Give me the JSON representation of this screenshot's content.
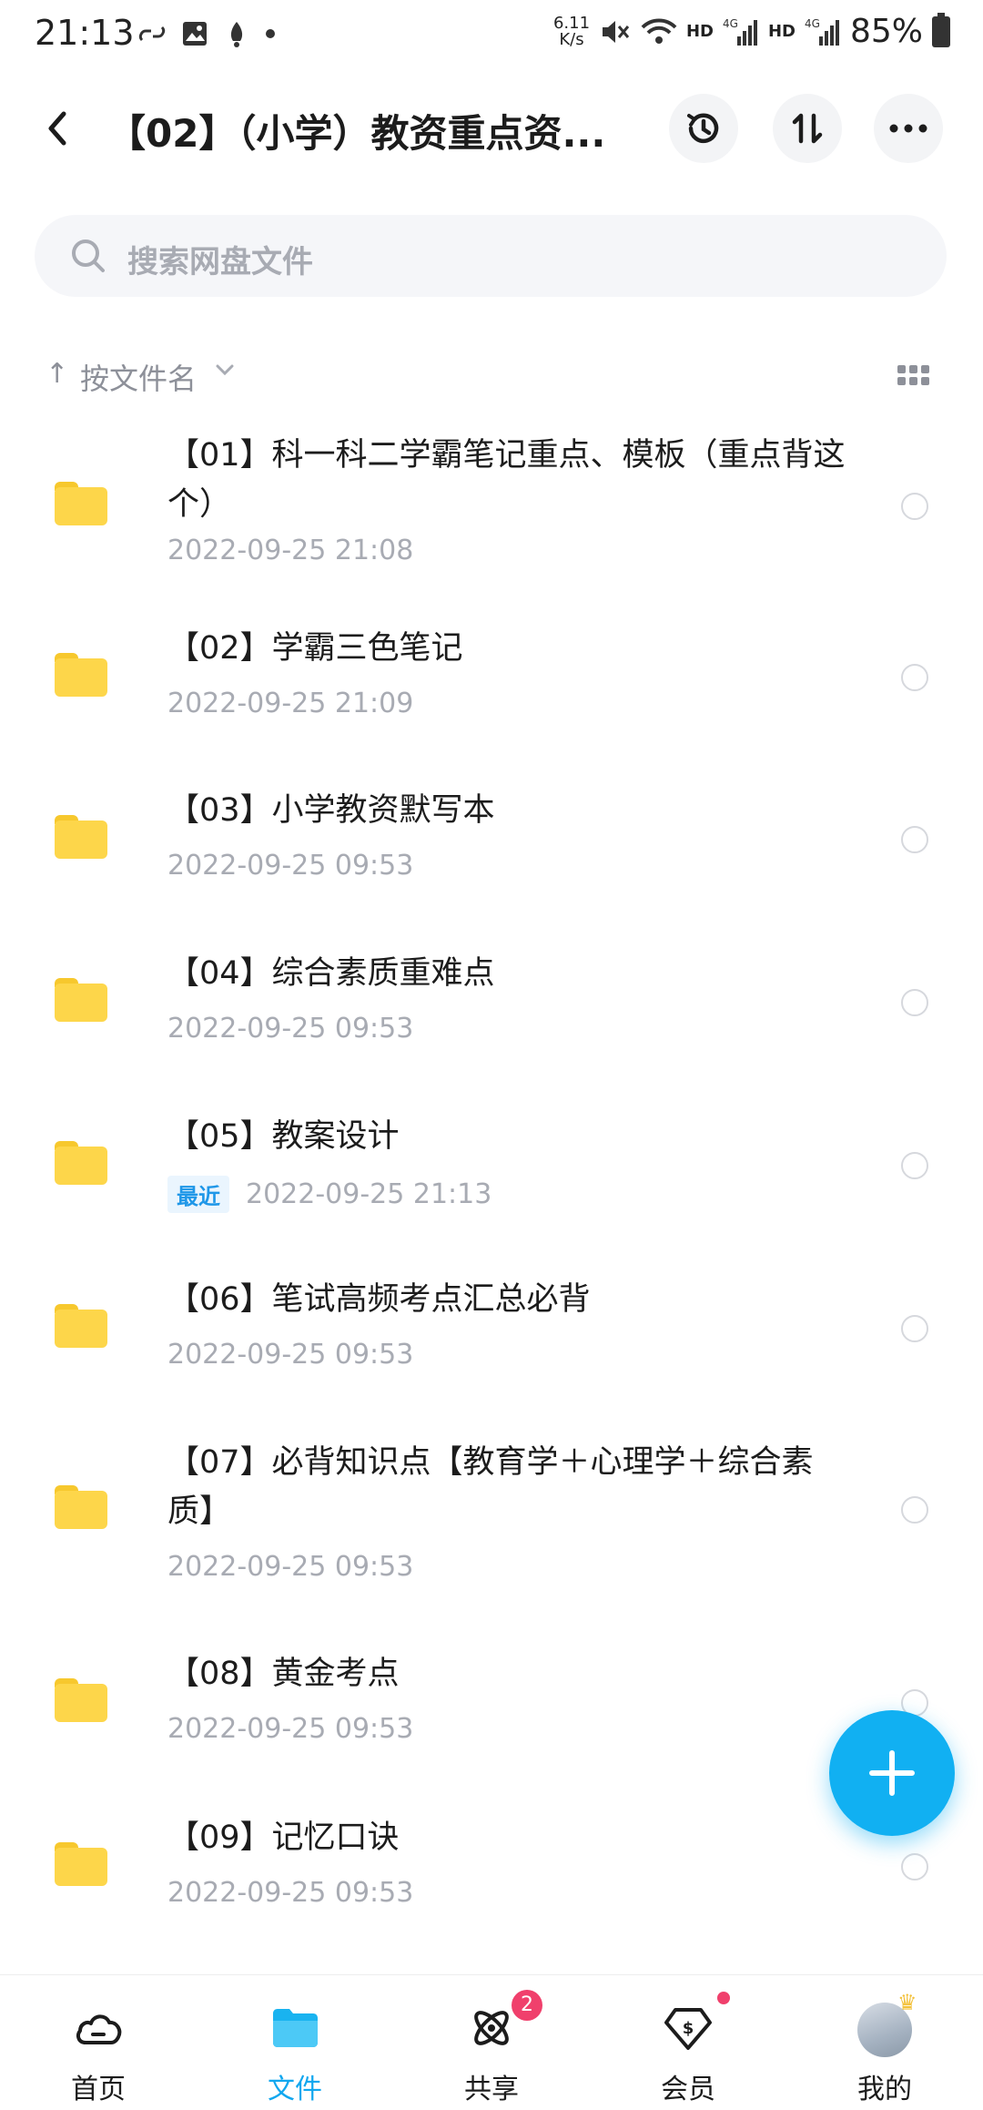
{
  "status_bar": {
    "time": "21:13",
    "net_speed_value": "6.11",
    "net_speed_unit": "K/s",
    "hd1": "HD",
    "hd2": "HD",
    "signal_label1": "4G",
    "signal_label2": "4G",
    "battery": "85%"
  },
  "header": {
    "title": "【02】（小学）教资重点资...",
    "icons": [
      "back-icon",
      "history-icon",
      "sort-icon",
      "more-icon"
    ]
  },
  "search": {
    "placeholder": "搜索网盘文件"
  },
  "sort": {
    "arrow": "↑",
    "label": "按文件名"
  },
  "files": [
    {
      "name": "【01】科一科二学霸笔记重点、模板（重点背这个）",
      "date": "2022-09-25  21:08",
      "badge": ""
    },
    {
      "name": "【02】学霸三色笔记",
      "date": "2022-09-25  21:09",
      "badge": ""
    },
    {
      "name": "【03】小学教资默写本",
      "date": "2022-09-25  09:53",
      "badge": ""
    },
    {
      "name": "【04】综合素质重难点",
      "date": "2022-09-25  09:53",
      "badge": ""
    },
    {
      "name": "【05】教案设计",
      "date": "2022-09-25  21:13",
      "badge": "最近"
    },
    {
      "name": "【06】笔试高频考点汇总必背",
      "date": "2022-09-25  09:53",
      "badge": ""
    },
    {
      "name": "【07】必背知识点【教育学＋心理学＋综合素质】",
      "date": "2022-09-25  09:53",
      "badge": ""
    },
    {
      "name": "【08】黄金考点",
      "date": "2022-09-25  09:53",
      "badge": ""
    },
    {
      "name": "【09】记忆口诀",
      "date": "2022-09-25  09:53",
      "badge": ""
    }
  ],
  "nav": {
    "home": "首页",
    "files": "文件",
    "share": "共享",
    "share_badge": "2",
    "vip": "会员",
    "mine": "我的"
  },
  "colors": {
    "accent": "#11b0f2",
    "folder": "#fdd64a",
    "badge": "#f0406c"
  }
}
